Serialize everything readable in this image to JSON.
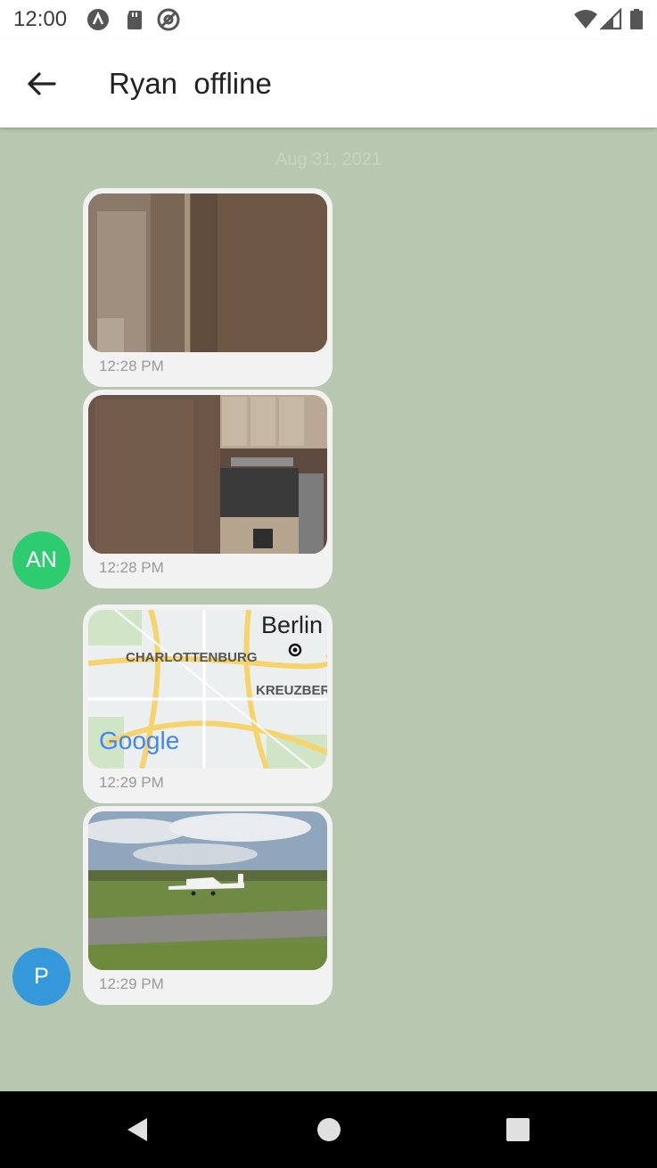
{
  "status_bar": {
    "time": "12:00",
    "left_icons": [
      "a-logo-icon",
      "sd-card-icon",
      "at-sign-icon"
    ],
    "right_icons": [
      "wifi-icon",
      "signal-icon",
      "battery-icon"
    ]
  },
  "header": {
    "back_icon": "arrow-left-icon",
    "title": "Ryan  offline"
  },
  "chat": {
    "date_separator": "Aug 31, 2021",
    "messages": [
      {
        "type": "image",
        "content": "room-photo",
        "time": "12:28 PM"
      },
      {
        "type": "image",
        "content": "kitchen-photo",
        "time": "12:28 PM"
      },
      {
        "type": "location",
        "content": "map",
        "map_labels": {
          "city": "Berlin",
          "district_1": "CHARLOTTENBURG",
          "district_2": "KREUZBERG",
          "logo": "Google"
        },
        "time": "12:29 PM"
      },
      {
        "type": "image",
        "content": "airplane-photo",
        "time": "12:29 PM"
      }
    ],
    "avatars": [
      {
        "initials": "AN",
        "color": "#2ecc71"
      },
      {
        "initials": "P",
        "color": "#3498db"
      }
    ]
  },
  "nav_bar": {
    "buttons": [
      "back-triangle-icon",
      "home-circle-icon",
      "recents-square-icon"
    ]
  },
  "colors": {
    "chat_background": "#b8c7af",
    "bubble": "#f2f2f2",
    "header": "#ffffff"
  }
}
